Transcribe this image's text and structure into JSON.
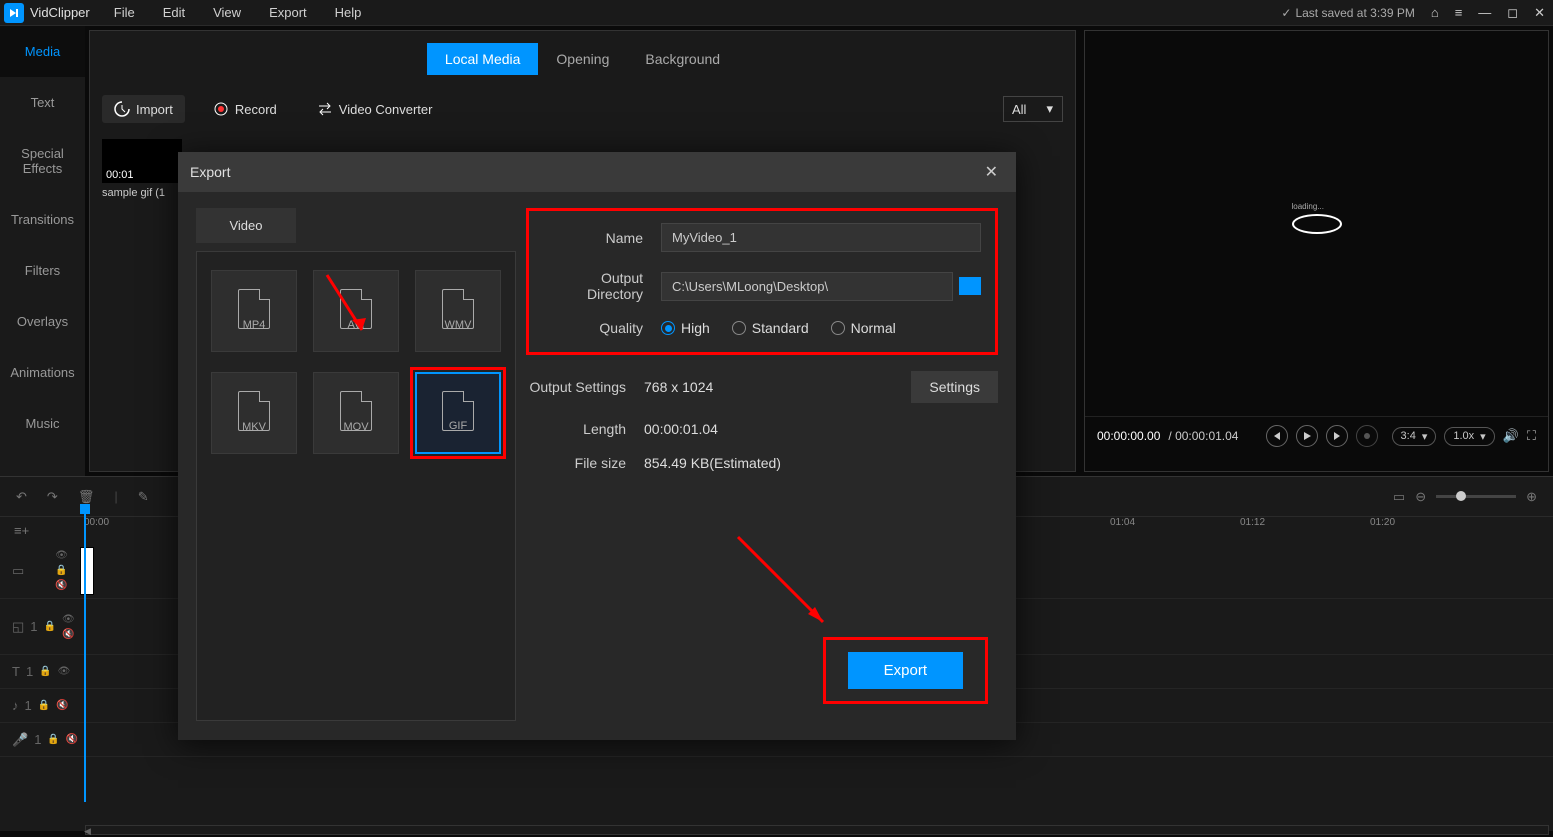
{
  "app": {
    "title": "VidClipper"
  },
  "menu": {
    "file": "File",
    "edit": "Edit",
    "view": "View",
    "export": "Export",
    "help": "Help"
  },
  "titlebar": {
    "last_saved": "Last saved at 3:39 PM"
  },
  "sidebar": {
    "media": "Media",
    "text": "Text",
    "effects": "Special Effects",
    "transitions": "Transitions",
    "filters": "Filters",
    "overlays": "Overlays",
    "animations": "Animations",
    "music": "Music"
  },
  "media_tabs": {
    "local": "Local Media",
    "opening": "Opening",
    "background": "Background"
  },
  "media_tools": {
    "import": "Import",
    "record": "Record",
    "convert": "Video Converter",
    "filter_all": "All"
  },
  "thumb": {
    "time": "00:01",
    "name": "sample gif (1"
  },
  "player": {
    "current": "00:00:00.00",
    "total": "/ 00:00:01.04",
    "ratio": "3:4",
    "speed": "1.0x"
  },
  "preview": {
    "loading": "loading..."
  },
  "timeline": {
    "ruler": [
      "00:00",
      "01:04",
      "01:12",
      "01:20"
    ],
    "track_num": "1"
  },
  "export_dialog": {
    "title": "Export",
    "tab_video": "Video",
    "formats": [
      "MP4",
      "AVI",
      "WMV",
      "MKV",
      "MOV",
      "GIF"
    ],
    "name_label": "Name",
    "name_value": "MyVideo_1",
    "dir_label": "Output Directory",
    "dir_value": "C:\\Users\\MLoong\\Desktop\\",
    "quality_label": "Quality",
    "quality": {
      "high": "High",
      "standard": "Standard",
      "normal": "Normal"
    },
    "output_settings_label": "Output Settings",
    "output_settings_value": "768 x 1024",
    "settings_btn": "Settings",
    "length_label": "Length",
    "length_value": "00:00:01.04",
    "filesize_label": "File size",
    "filesize_value": "854.49 KB(Estimated)",
    "export_btn": "Export"
  }
}
